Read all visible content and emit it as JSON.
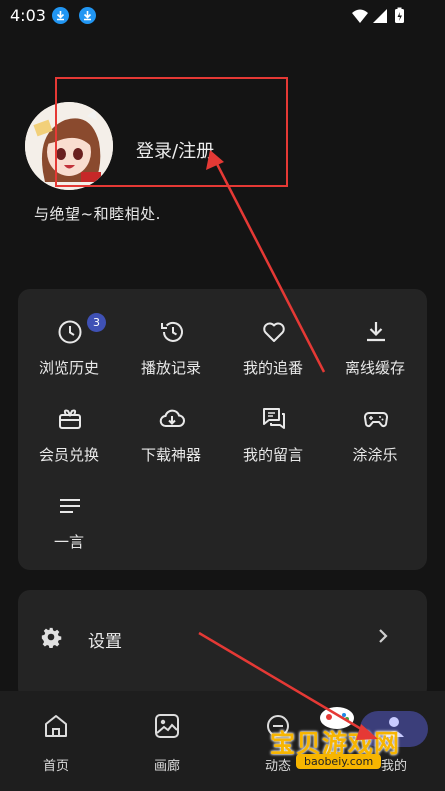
{
  "status_bar": {
    "time": "4:03"
  },
  "profile": {
    "login_label": "登录/注册",
    "motto": "与绝望~和睦相处."
  },
  "grid": {
    "items": [
      {
        "label": "浏览历史",
        "icon": "clock-icon",
        "badge": "3"
      },
      {
        "label": "播放记录",
        "icon": "history-icon"
      },
      {
        "label": "我的追番",
        "icon": "heart-icon"
      },
      {
        "label": "离线缓存",
        "icon": "download-icon"
      },
      {
        "label": "会员兑换",
        "icon": "gift-card-icon"
      },
      {
        "label": "下载神器",
        "icon": "cloud-download-icon"
      },
      {
        "label": "我的留言",
        "icon": "chat-bubbles-icon"
      },
      {
        "label": "涂涂乐",
        "icon": "gamepad-icon"
      },
      {
        "label": "一言",
        "icon": "lines-icon"
      }
    ]
  },
  "settings": {
    "label": "设置"
  },
  "bottom_nav": {
    "items": [
      {
        "label": "首页",
        "icon": "home-icon"
      },
      {
        "label": "画廊",
        "icon": "gallery-icon"
      },
      {
        "label": "动态",
        "icon": "activity-icon"
      },
      {
        "label": "我的",
        "icon": "user-icon"
      }
    ],
    "active": "我的"
  },
  "watermark": {
    "text": "宝贝游戏网",
    "url": "baobeiy.com"
  },
  "colors": {
    "background": "#141414",
    "card": "#242424",
    "accent": "#3b3e7a",
    "annotation": "#e53935",
    "badge": "#3f51b5"
  }
}
